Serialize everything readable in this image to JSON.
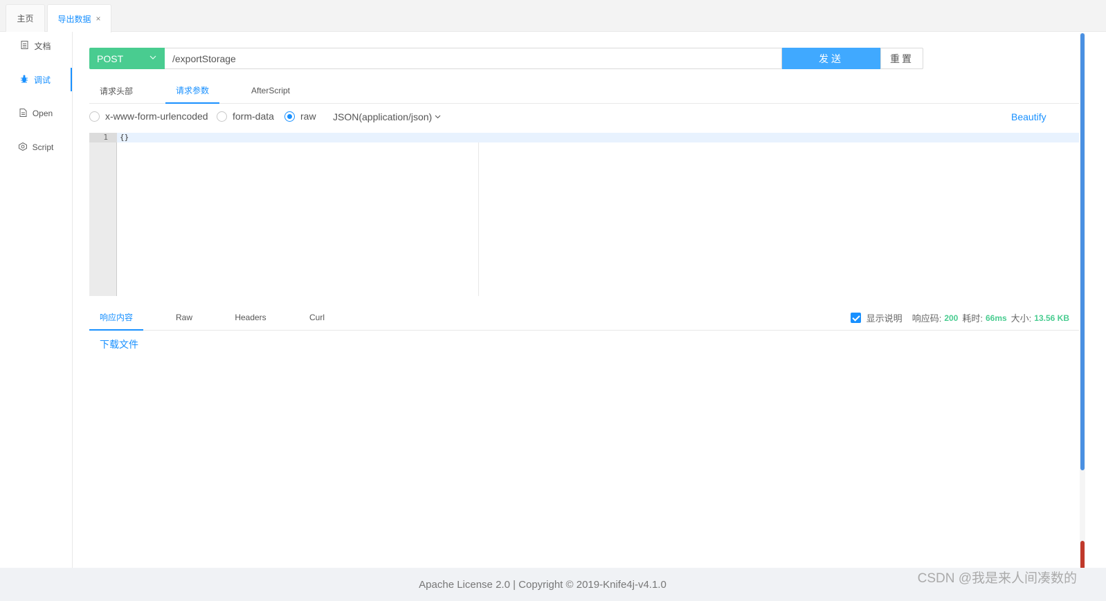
{
  "tabs": {
    "home": "主页",
    "active": "导出数据",
    "close": "×"
  },
  "sidebar": {
    "items": [
      {
        "label": "文档",
        "icon": "document-icon"
      },
      {
        "label": "调试",
        "icon": "bug-icon"
      },
      {
        "label": "Open",
        "icon": "file-icon"
      },
      {
        "label": "Script",
        "icon": "code-icon"
      }
    ]
  },
  "request": {
    "method": "POST",
    "url": "/exportStorage",
    "send_label": "发送",
    "reset_label": "重置"
  },
  "param_tabs": [
    "请求头部",
    "请求参数",
    "AfterScript"
  ],
  "body_options": {
    "radios": [
      "x-www-form-urlencoded",
      "form-data",
      "raw"
    ],
    "selected": "raw",
    "content_type": "JSON(application/json)",
    "beautify": "Beautify"
  },
  "editor": {
    "line_number": "1",
    "content": "{}"
  },
  "response_tabs": [
    "响应内容",
    "Raw",
    "Headers",
    "Curl"
  ],
  "response_meta": {
    "show_desc": "显示说明",
    "code_label": "响应码:",
    "code": "200",
    "time_label": "耗时:",
    "time": "66ms",
    "size_label": "大小:",
    "size": "13.56 KB"
  },
  "download_link": "下载文件",
  "footer": "Apache License 2.0 | Copyright © 2019-Knife4j-v4.1.0",
  "watermark": "CSDN @我是来人间凑数的",
  "colors": {
    "accent": "#1890ff",
    "method_post": "#49cc90",
    "send_button": "#40a9ff"
  }
}
